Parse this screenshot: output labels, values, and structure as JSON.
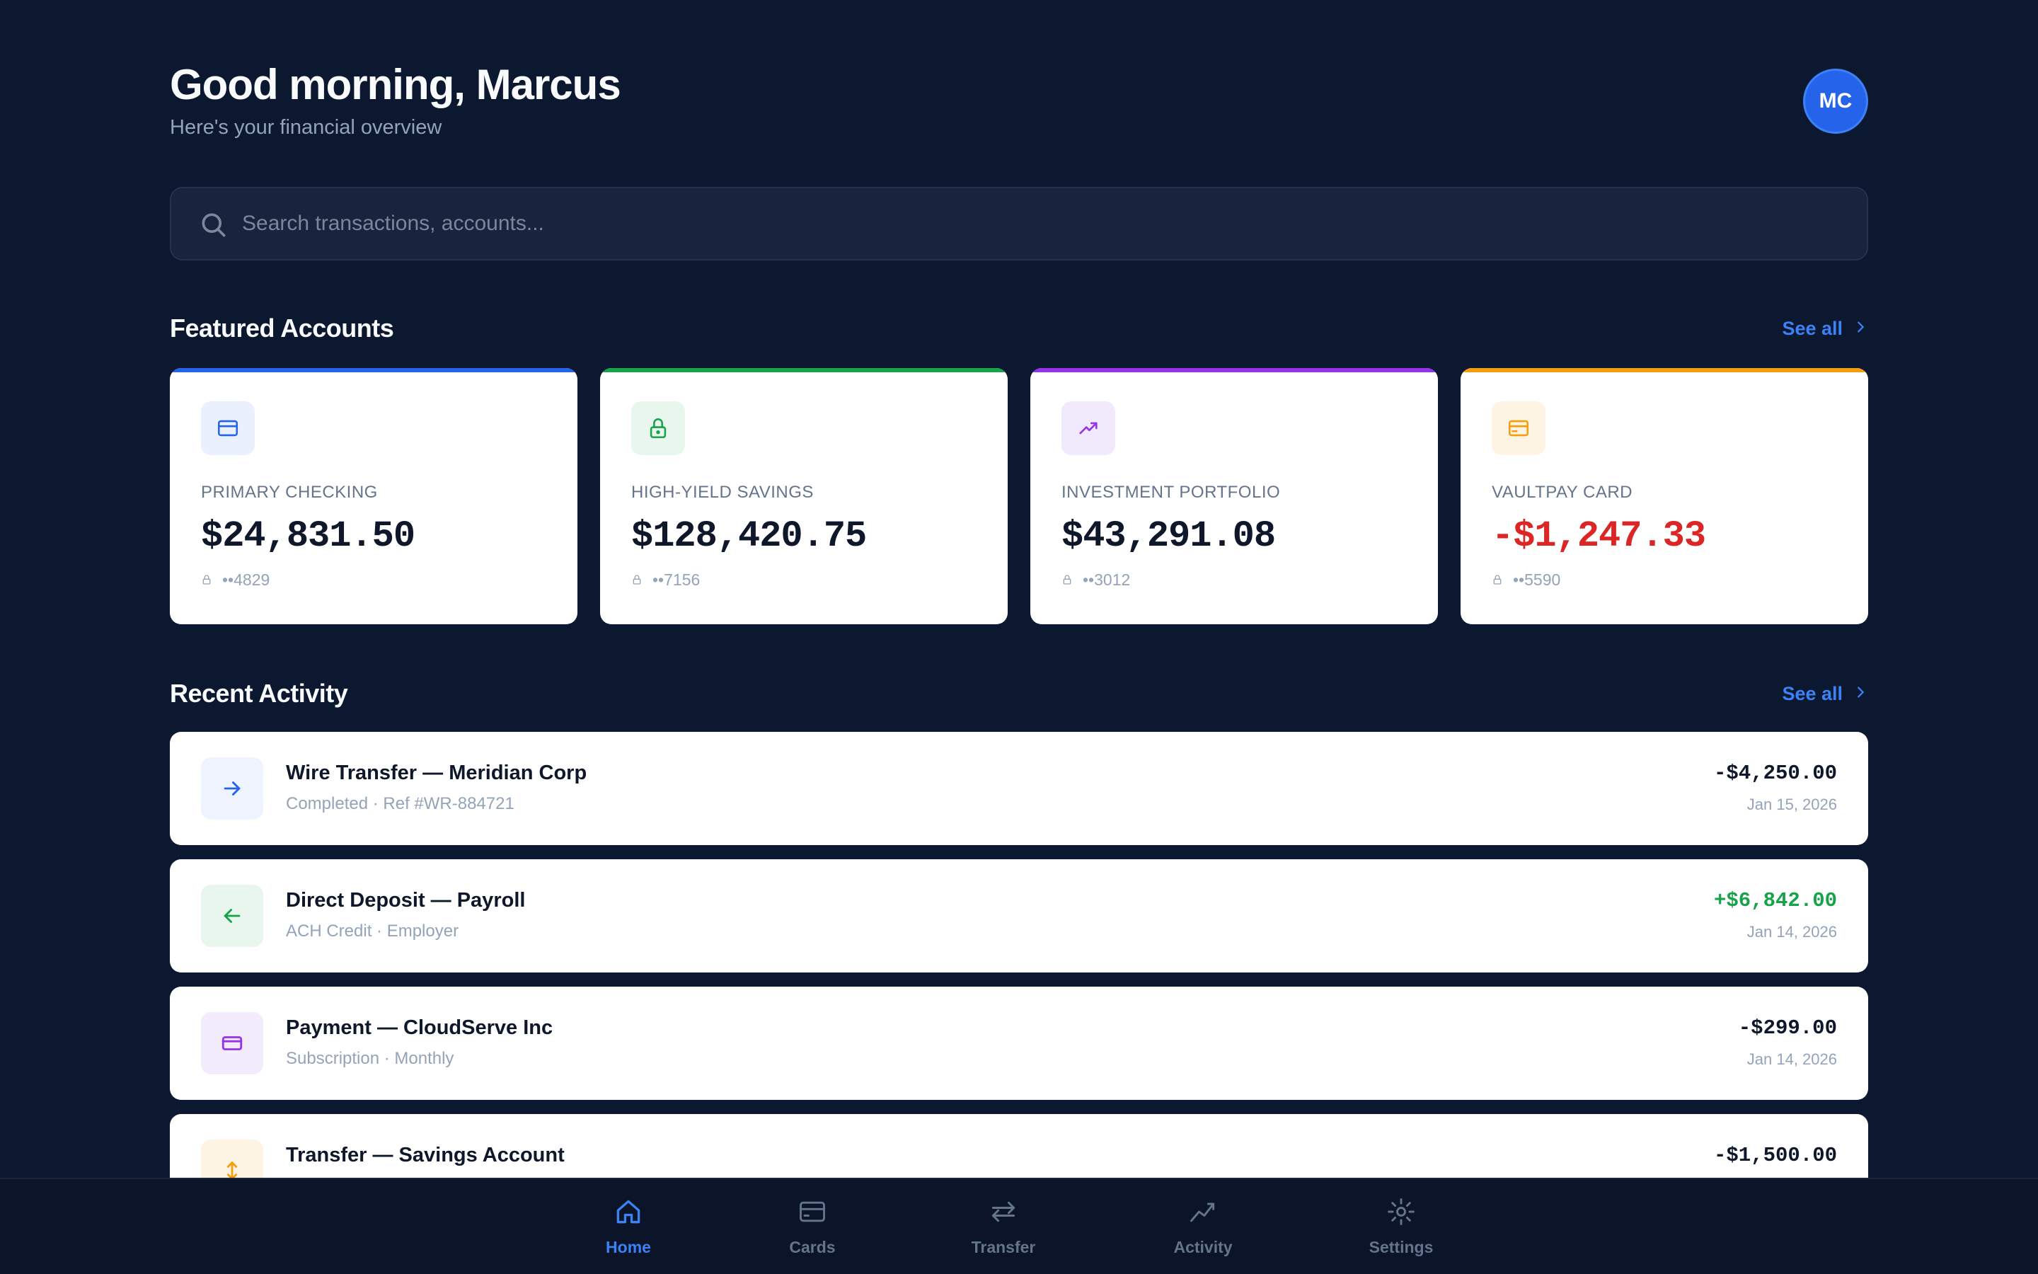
{
  "header": {
    "greeting": "Good morning, Marcus",
    "subtitle": "Here's your financial overview",
    "avatar_initials": "MC"
  },
  "search": {
    "placeholder": "Search transactions, accounts...",
    "icon": "search-icon"
  },
  "featured": {
    "title": "Featured Accounts",
    "see_all": "See all",
    "accounts": [
      {
        "label": "PRIMARY CHECKING",
        "balance": "$24,831.50",
        "number": "••4829",
        "icon": "credit-card-icon",
        "accent": "#2563eb",
        "icon_bg": "#eaf0fe"
      },
      {
        "label": "HIGH-YIELD SAVINGS",
        "balance": "$128,420.75",
        "number": "••7156",
        "icon": "lock-icon",
        "accent": "#16a34a",
        "icon_bg": "#e8f6ee"
      },
      {
        "label": "INVESTMENT PORTFOLIO",
        "balance": "$43,291.08",
        "number": "••3012",
        "icon": "trending-up-icon",
        "accent": "#9333ea",
        "icon_bg": "#f1eafd"
      },
      {
        "label": "VAULTPAY CARD",
        "balance": "-$1,247.33",
        "number": "••5590",
        "icon": "credit-card-icon",
        "accent": "#f59e0b",
        "icon_bg": "#fef4e4",
        "balance_color": "#dc2626"
      }
    ]
  },
  "activity": {
    "title": "Recent Activity",
    "see_all": "See all",
    "transactions": [
      {
        "title": "Wire Transfer — Meridian Corp",
        "subtitle": "Completed · Ref #WR-884721",
        "amount": "-$4,250.00",
        "date": "Jan 15, 2026",
        "icon": "arrow-right-icon",
        "icon_color": "#2563eb",
        "icon_bg": "#eef3fe"
      },
      {
        "title": "Direct Deposit — Payroll",
        "subtitle": "ACH Credit · Employer",
        "amount": "+$6,842.00",
        "date": "Jan 14, 2026",
        "icon": "arrow-left-icon",
        "icon_color": "#16a34a",
        "icon_bg": "#e8f6ee",
        "amount_color": "#16a34a"
      },
      {
        "title": "Payment — CloudServe Inc",
        "subtitle": "Subscription · Monthly",
        "amount": "-$299.00",
        "date": "Jan 14, 2026",
        "icon": "credit-card-icon",
        "icon_color": "#9333ea",
        "icon_bg": "#f3ecfd"
      },
      {
        "title": "Transfer — Savings Account",
        "subtitle": "",
        "amount": "-$1,500.00",
        "date": "",
        "icon": "arrow-up-down-icon",
        "icon_color": "#f59e0b",
        "icon_bg": "#fef4e4"
      }
    ]
  },
  "nav": {
    "items": [
      {
        "label": "Home",
        "icon": "home-icon",
        "active": true
      },
      {
        "label": "Cards",
        "icon": "credit-card-icon"
      },
      {
        "label": "Transfer",
        "icon": "transfer-icon"
      },
      {
        "label": "Activity",
        "icon": "activity-chart-icon"
      },
      {
        "label": "Settings",
        "icon": "settings-icon"
      }
    ],
    "active_color": "#3b82f6",
    "inactive_color": "#64748b"
  }
}
